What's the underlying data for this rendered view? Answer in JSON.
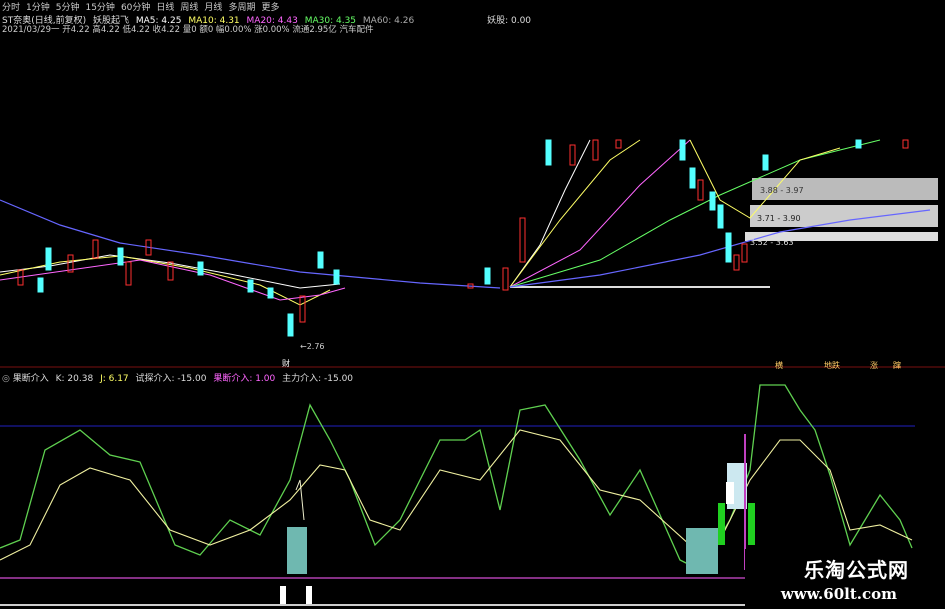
{
  "toolbar": [
    "分时",
    "1分钟",
    "5分钟",
    "15分钟",
    "60分钟",
    "日线",
    "周线",
    "月线",
    "多周期",
    "更多"
  ],
  "header1": {
    "stock": "ST奈奥(日线,前复权)",
    "indicator": "妖股起飞",
    "ma5": "MA5: 4.25",
    "ma10": "MA10: 4.31",
    "ma20": "MA20: 4.43",
    "ma30": "MA30: 4.35",
    "ma60": "MA60: 4.26",
    "yaogu": "妖股: 0.00"
  },
  "header2": "2021/03/29一 开4.22 高4.22 低4.22 收4.22 量0 额0 幅0.00% 涨0.00% 流通2.95亿 汽车配件",
  "price_labels": {
    "low": "2.76",
    "box1": "3.88 - 3.97",
    "box2": "3.71 - 3.90",
    "box3": "3.52 - 3.63"
  },
  "markers": {
    "left": "财",
    "m1": "横",
    "m2": "地跌",
    "m3": "涨",
    "m4": "蹿"
  },
  "header3": {
    "name": "果断介入",
    "k": "K: 20.38",
    "j": "J: 6.17",
    "try_in": "试探介入: -15.00",
    "decisive": "果断介入: 1.00",
    "main": "主力介入: -15.00"
  },
  "watermark": {
    "title": "乐淘公式网",
    "url": "www.60lt.com"
  },
  "colors": {
    "up": "#ff3030",
    "down": "#54ffff",
    "ma5": "#ffffff",
    "ma10": "#ffff66",
    "ma20": "#ff66ff",
    "ma30": "#66ff66",
    "ma60": "#6666ff",
    "k": "#5fd050",
    "d": "#f0f0a0",
    "box": "#bbbbbb"
  }
}
